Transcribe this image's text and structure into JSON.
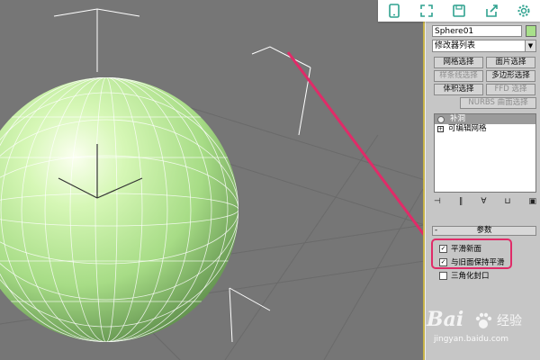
{
  "toolbar": {
    "icons": [
      "tablet-icon",
      "expand-icon",
      "save-icon",
      "share-icon",
      "gear-icon"
    ]
  },
  "panel": {
    "object_name": "Sphere01",
    "object_color": "#a8e08a",
    "modifier_list": "修改器列表",
    "buttons": [
      {
        "label": "网格选择",
        "enabled": true
      },
      {
        "label": "面片选择",
        "enabled": true
      },
      {
        "label": "样条线选择",
        "enabled": false
      },
      {
        "label": "多边形选择",
        "enabled": true
      },
      {
        "label": "体积选择",
        "enabled": true
      },
      {
        "label": "FFD 选择",
        "enabled": false
      },
      {
        "label": "NURBS 曲面选择",
        "enabled": false
      }
    ],
    "stack": {
      "head": "补洞",
      "item": "可编辑网格"
    },
    "rollout": "参数",
    "checkboxes": [
      {
        "label": "平滑新面",
        "checked": true
      },
      {
        "label": "与旧面保持平滑",
        "checked": true
      },
      {
        "label": "三角化封口",
        "checked": false
      }
    ]
  },
  "watermark": {
    "brand": "Bai",
    "brand2": "经验",
    "url": "jingyan.baidu.com"
  },
  "colors": {
    "highlight": "#e02b68",
    "sphere": "#b8f09a",
    "viewport": "#767676"
  }
}
